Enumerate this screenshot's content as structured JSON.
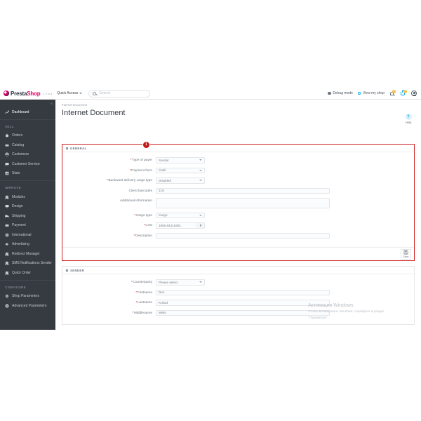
{
  "navbar": {
    "brand_first": "Presta",
    "brand_second": "Shop",
    "version": "1.7.6.4",
    "quick_access": "Quick Access",
    "search_placeholder": "Search",
    "debug_mode": "Debug mode",
    "view_my_shop": "View my shop",
    "bell_badge": "1",
    "cart_badge": "0"
  },
  "sidebar": {
    "dashboard": "Dashboard",
    "sections": [
      {
        "title": "SELL",
        "items": [
          {
            "label": "Orders",
            "icon": "shopping-bag-icon"
          },
          {
            "label": "Catalog",
            "icon": "catalog-icon"
          },
          {
            "label": "Customers",
            "icon": "customers-icon"
          },
          {
            "label": "Customer Service",
            "icon": "chat-icon"
          },
          {
            "label": "Stats",
            "icon": "stats-icon"
          }
        ]
      },
      {
        "title": "IMPROVE",
        "items": [
          {
            "label": "Modules",
            "icon": "puzzle-icon"
          },
          {
            "label": "Design",
            "icon": "monitor-icon"
          },
          {
            "label": "Shipping",
            "icon": "truck-icon"
          },
          {
            "label": "Payment",
            "icon": "card-icon"
          },
          {
            "label": "International",
            "icon": "globe-icon"
          },
          {
            "label": "Advertising",
            "icon": "megaphone-icon"
          },
          {
            "label": "Redirect Manager",
            "icon": "plugin-icon"
          },
          {
            "label": "SMS Notifications Sender",
            "icon": "plugin-icon"
          },
          {
            "label": "Quick Order",
            "icon": "plugin-icon"
          }
        ]
      },
      {
        "title": "CONFIGURE",
        "items": [
          {
            "label": "Shop Parameters",
            "icon": "gear-icon"
          },
          {
            "label": "Advanced Parameters",
            "icon": "sliders-icon"
          }
        ]
      }
    ]
  },
  "content": {
    "breadcrumb": "Internet Document",
    "page_title": "Internet Document",
    "help_label": "Help",
    "help_glyph": "?"
  },
  "panels": [
    {
      "title": "GENERAL",
      "marker": "1",
      "save_label": "Save",
      "fields": [
        {
          "label": "Type of payer",
          "required": true,
          "type": "select",
          "value": "Sender"
        },
        {
          "label": "Payment form",
          "required": true,
          "type": "select",
          "value": "Cash"
        },
        {
          "label": "Backward delivery cargo type",
          "required": true,
          "type": "select",
          "value": "Disabled"
        },
        {
          "label": "Client barcodes",
          "required": false,
          "type": "input",
          "value": "218"
        },
        {
          "label": "Additional information",
          "required": false,
          "type": "textarea",
          "value": ""
        },
        {
          "label": "Cargo type",
          "required": true,
          "type": "select",
          "value": "Cargo"
        },
        {
          "label": "Cost",
          "required": true,
          "type": "input-group",
          "value": "1856.84415481",
          "addon": "₴"
        },
        {
          "label": "Description",
          "required": true,
          "type": "input",
          "value": ""
        }
      ]
    },
    {
      "title": "SENDER",
      "fields": [
        {
          "label": "Counterparty",
          "required": true,
          "type": "select",
          "value": "Please select"
        },
        {
          "label": "Firstname",
          "required": true,
          "type": "input",
          "value": "Den"
        },
        {
          "label": "Lastname",
          "required": true,
          "type": "input",
          "value": "Krikod"
        },
        {
          "label": "Middlename",
          "required": true,
          "type": "input",
          "value": "aleks"
        }
      ]
    }
  ],
  "watermark": {
    "title": "Активация Windows",
    "line1": "Чтобы активировать Windows, перейдите в раздел",
    "line2": "\"Параметры\"."
  },
  "colors": {
    "sidebar_bg": "#363a41",
    "brand_pink": "#df0067",
    "accent_red": "#cf2020",
    "accent_blue": "#00aff0"
  }
}
